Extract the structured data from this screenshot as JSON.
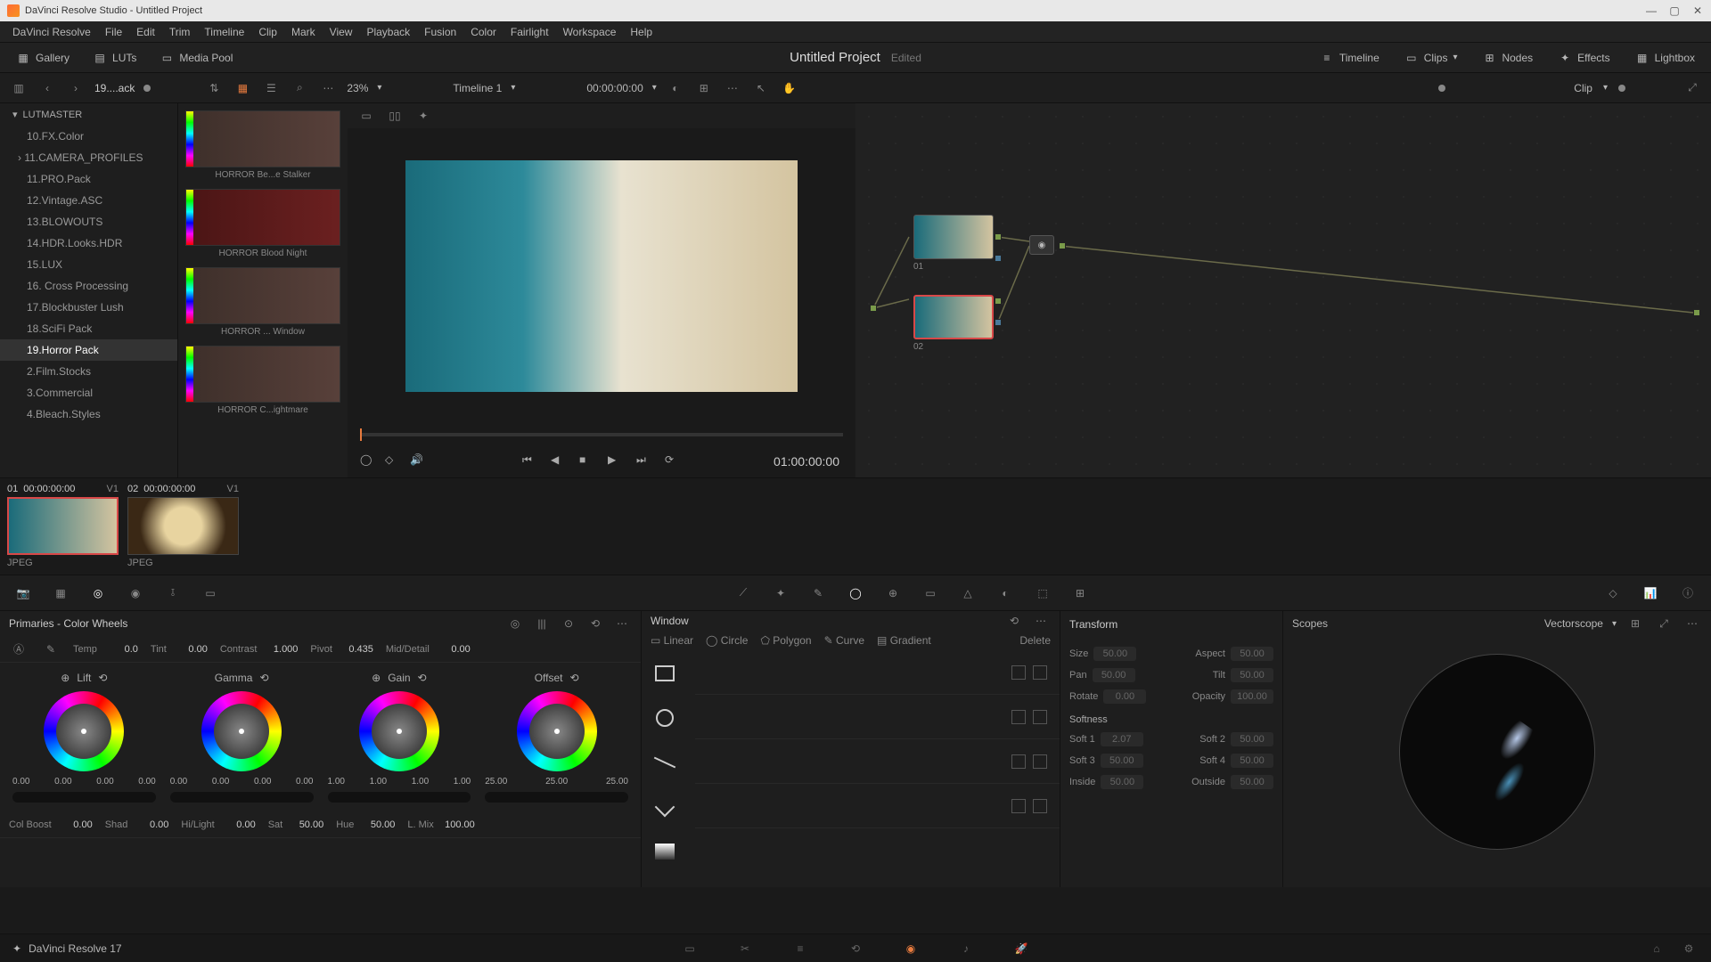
{
  "titlebar": {
    "text": "DaVinci Resolve Studio - Untitled Project"
  },
  "menu": [
    "DaVinci Resolve",
    "File",
    "Edit",
    "Trim",
    "Timeline",
    "Clip",
    "Mark",
    "View",
    "Playback",
    "Fusion",
    "Color",
    "Fairlight",
    "Workspace",
    "Help"
  ],
  "top_toolbar": {
    "gallery": "Gallery",
    "luts": "LUTs",
    "media_pool": "Media Pool",
    "project": "Untitled Project",
    "status": "Edited",
    "timeline_btn": "Timeline",
    "clips_btn": "Clips",
    "nodes_btn": "Nodes",
    "effects_btn": "Effects",
    "lightbox_btn": "Lightbox"
  },
  "secondary": {
    "breadcrumb": "19....ack",
    "zoom": "23%",
    "timeline_name": "Timeline 1",
    "timecode": "00:00:00:00",
    "clip_mode": "Clip"
  },
  "lut_tree": {
    "header": "LUTMASTER",
    "items": [
      {
        "label": "10.FX.Color"
      },
      {
        "label": "11.CAMERA_PROFILES",
        "parent": true
      },
      {
        "label": "11.PRO.Pack"
      },
      {
        "label": "12.Vintage.ASC"
      },
      {
        "label": "13.BLOWOUTS"
      },
      {
        "label": "14.HDR.Looks.HDR"
      },
      {
        "label": "15.LUX"
      },
      {
        "label": "16. Cross Processing"
      },
      {
        "label": "17.Blockbuster Lush"
      },
      {
        "label": "18.SciFi Pack"
      },
      {
        "label": "19.Horror Pack",
        "selected": true
      },
      {
        "label": "2.Film.Stocks"
      },
      {
        "label": "3.Commercial"
      },
      {
        "label": "4.Bleach.Styles"
      }
    ]
  },
  "lut_thumbs": [
    {
      "label": "HORROR Be...e Stalker"
    },
    {
      "label": "HORROR Blood Night",
      "red": true
    },
    {
      "label": "HORROR ... Window"
    },
    {
      "label": "HORROR C...ightmare"
    }
  ],
  "viewer": {
    "timecode": "01:00:00:00"
  },
  "nodes": {
    "n1": "01",
    "n2": "02"
  },
  "clips": [
    {
      "idx": "01",
      "tc": "00:00:00:00",
      "track": "V1",
      "format": "JPEG",
      "kind": "beach",
      "selected": true
    },
    {
      "idx": "02",
      "tc": "00:00:00:00",
      "track": "V1",
      "format": "JPEG",
      "kind": "coffee"
    }
  ],
  "primaries": {
    "title": "Primaries - Color Wheels",
    "row1": {
      "temp_l": "Temp",
      "temp_v": "0.0",
      "tint_l": "Tint",
      "tint_v": "0.00",
      "contrast_l": "Contrast",
      "contrast_v": "1.000",
      "pivot_l": "Pivot",
      "pivot_v": "0.435",
      "md_l": "Mid/Detail",
      "md_v": "0.00"
    },
    "wheels": {
      "lift": {
        "title": "Lift",
        "v": [
          "0.00",
          "0.00",
          "0.00",
          "0.00"
        ]
      },
      "gamma": {
        "title": "Gamma",
        "v": [
          "0.00",
          "0.00",
          "0.00",
          "0.00"
        ]
      },
      "gain": {
        "title": "Gain",
        "v": [
          "1.00",
          "1.00",
          "1.00",
          "1.00"
        ]
      },
      "offset": {
        "title": "Offset",
        "v": [
          "25.00",
          "25.00",
          "25.00"
        ]
      }
    },
    "row2": {
      "cb_l": "Col Boost",
      "cb_v": "0.00",
      "shad_l": "Shad",
      "shad_v": "0.00",
      "hl_l": "Hi/Light",
      "hl_v": "0.00",
      "sat_l": "Sat",
      "sat_v": "50.00",
      "hue_l": "Hue",
      "hue_v": "50.00",
      "lm_l": "L. Mix",
      "lm_v": "100.00"
    }
  },
  "window": {
    "title": "Window",
    "shapes": [
      "Linear",
      "Circle",
      "Polygon",
      "Curve",
      "Gradient"
    ],
    "delete": "Delete"
  },
  "transform": {
    "title": "Transform",
    "size_l": "Size",
    "size_v": "50.00",
    "aspect_l": "Aspect",
    "aspect_v": "50.00",
    "pan_l": "Pan",
    "pan_v": "50.00",
    "tilt_l": "Tilt",
    "tilt_v": "50.00",
    "rotate_l": "Rotate",
    "rotate_v": "0.00",
    "opacity_l": "Opacity",
    "opacity_v": "100.00",
    "softness": "Softness",
    "s1_l": "Soft 1",
    "s1_v": "2.07",
    "s2_l": "Soft 2",
    "s2_v": "50.00",
    "s3_l": "Soft 3",
    "s3_v": "50.00",
    "s4_l": "Soft 4",
    "s4_v": "50.00",
    "in_l": "Inside",
    "in_v": "50.00",
    "out_l": "Outside",
    "out_v": "50.00"
  },
  "scopes": {
    "title": "Scopes",
    "type": "Vectorscope"
  },
  "footer": {
    "app": "DaVinci Resolve 17"
  }
}
